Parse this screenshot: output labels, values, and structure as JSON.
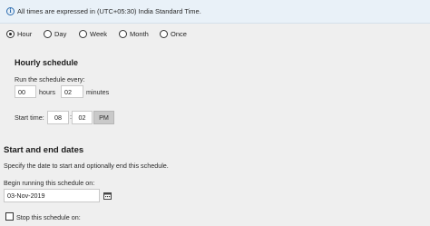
{
  "info": {
    "text": "All times are expressed in (UTC+05:30) India Standard Time."
  },
  "frequency": {
    "options": [
      {
        "label": "Hour",
        "checked": true
      },
      {
        "label": "Day",
        "checked": false
      },
      {
        "label": "Week",
        "checked": false
      },
      {
        "label": "Month",
        "checked": false
      },
      {
        "label": "Once",
        "checked": false
      }
    ]
  },
  "hourly": {
    "heading": "Hourly schedule",
    "run_label": "Run the schedule every:",
    "hours_value": "00",
    "hours_label": "hours",
    "minutes_value": "02",
    "minutes_label": "minutes",
    "start_label": "Start time:",
    "start_hour": "08",
    "start_sep": ":",
    "start_minute": "02",
    "start_ampm": "PM"
  },
  "dates": {
    "heading": "Start and end dates",
    "desc": "Specify the date to start and optionally end this schedule.",
    "begin_label": "Begin running this schedule on:",
    "begin_value": "03-Nov-2019",
    "stop_label": "Stop this schedule on:"
  },
  "icons": {
    "info": "info-icon",
    "calendar": "calendar-icon"
  }
}
